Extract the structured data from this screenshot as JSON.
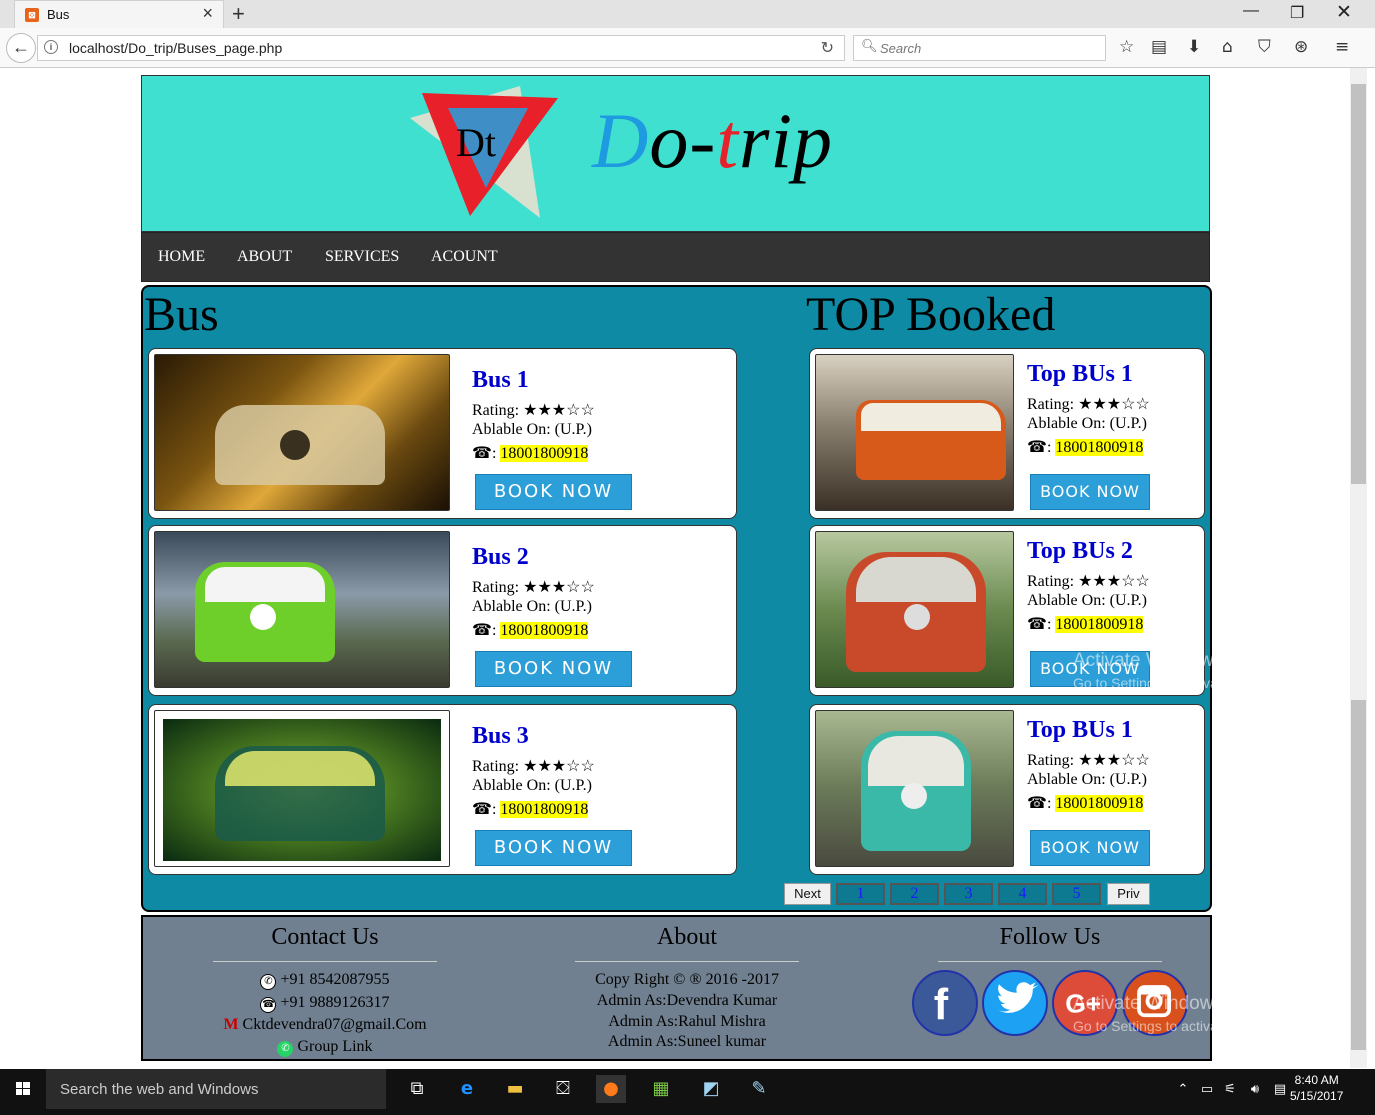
{
  "browser": {
    "tab_title": "Bus",
    "tab_favicon": "xampp-icon",
    "url": "localhost/Do_trip/Buses_page.php",
    "search_placeholder": "Search"
  },
  "site": {
    "brand_d": "D",
    "brand_o": "o-",
    "brand_t": "t",
    "brand_rest": "rip",
    "logo_text": "Dt",
    "menu": [
      "HOME",
      "ABOUT",
      "SERVICES",
      "ACOUNT"
    ]
  },
  "bus_section": {
    "heading": "Bus",
    "cards": [
      {
        "name": "Bus 1",
        "rating_label": "Rating:",
        "stars": "★★★☆☆",
        "available": "Ablable On: (U.P.)",
        "phone_icon": "☎",
        "phone": "18001800918",
        "button": "BOOK NOW"
      },
      {
        "name": "Bus 2",
        "rating_label": "Rating:",
        "stars": "★★★☆☆",
        "available": "Ablable On: (U.P.)",
        "phone_icon": "☎",
        "phone": "18001800918",
        "button": "BOOK NOW"
      },
      {
        "name": "Bus 3",
        "rating_label": "Rating:",
        "stars": "★★★☆☆",
        "available": "Ablable On: (U.P.)",
        "phone_icon": "☎",
        "phone": "18001800918",
        "button": "BOOK NOW"
      }
    ]
  },
  "top_section": {
    "heading": "TOP Booked",
    "cards": [
      {
        "name": "Top BUs 1",
        "rating_label": "Rating:",
        "stars": "★★★☆☆",
        "available": "Ablable On: (U.P.)",
        "phone_icon": "☎",
        "phone": "18001800918",
        "button": "BOOK NOW"
      },
      {
        "name": "Top BUs 2",
        "rating_label": "Rating:",
        "stars": "★★★☆☆",
        "available": "Ablable On: (U.P.)",
        "phone_icon": "☎",
        "phone": "18001800918",
        "button": "BOOK NOW"
      },
      {
        "name": "Top BUs 1",
        "rating_label": "Rating:",
        "stars": "★★★☆☆",
        "available": "Ablable On: (U.P.)",
        "phone_icon": "☎",
        "phone": "18001800918",
        "button": "BOOK NOW"
      }
    ]
  },
  "pagination": {
    "next": "Next",
    "pages": [
      "1",
      "2",
      "3",
      "4",
      "5"
    ],
    "prev": "Priv"
  },
  "footer": {
    "contact_heading": "Contact Us",
    "phone1": "+91 8542087955",
    "phone2": "+91 9889126317",
    "email": "Cktdevendra07@gmail.Com",
    "group_link": "Group Link",
    "about_heading": "About",
    "copyright": "Copy Right © ® 2016 -2017",
    "admin1": "Admin As:Devendra Kumar",
    "admin2": "Admin As:Rahul Mishra",
    "admin3": "Admin As:Suneel kumar",
    "follow_heading": "Follow Us",
    "social": [
      "facebook-icon",
      "twitter-icon",
      "google-plus-icon",
      "instagram-icon"
    ]
  },
  "watermark": {
    "line1": "Activate Windows",
    "line2": "Go to Settings to activate Windows."
  },
  "taskbar": {
    "search_placeholder": "Search the web and Windows",
    "time": "8:40 AM",
    "date": "5/15/2017"
  },
  "colors": {
    "header_bg": "#40e0d0",
    "menu_bg": "#333333",
    "content_bg": "#0e8aa4",
    "footer_bg": "#708090",
    "bus_name": "#0000cc",
    "phone_highlight": "#ffff00",
    "book_button": "#2d9fd8"
  }
}
